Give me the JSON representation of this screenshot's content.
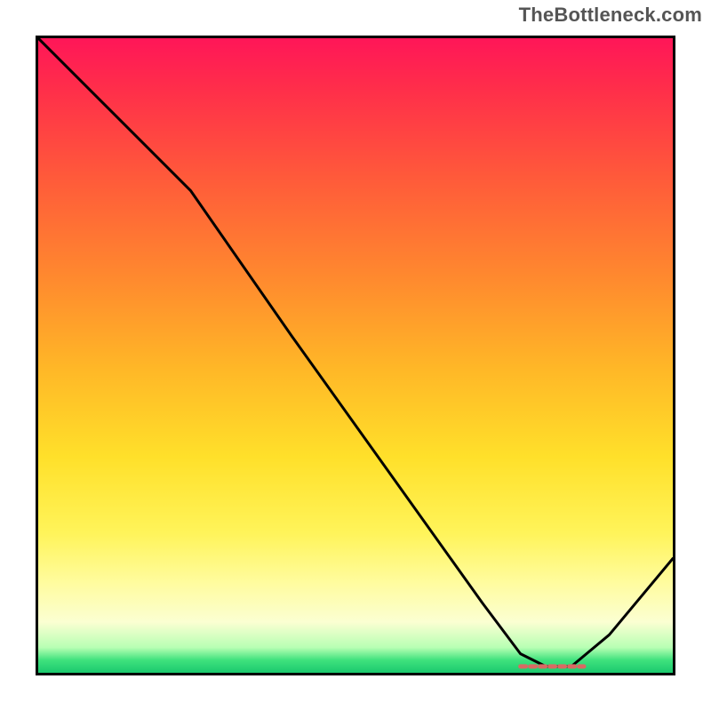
{
  "watermark": "TheBottleneck.com",
  "chart_data": {
    "type": "line",
    "title": "",
    "xlabel": "",
    "ylabel": "",
    "xlim": [
      0,
      100
    ],
    "ylim": [
      0,
      100
    ],
    "grid": false,
    "legend": false,
    "background": {
      "kind": "vertical-gradient",
      "stops": [
        {
          "pos": 0,
          "color": "#ff1658"
        },
        {
          "pos": 0.22,
          "color": "#ff5a3a"
        },
        {
          "pos": 0.52,
          "color": "#ffb727"
        },
        {
          "pos": 0.78,
          "color": "#fff45a"
        },
        {
          "pos": 0.92,
          "color": "#fbffd2"
        },
        {
          "pos": 0.98,
          "color": "#3fe27d"
        },
        {
          "pos": 1.0,
          "color": "#1bc96e"
        }
      ]
    },
    "series": [
      {
        "name": "bottleneck-curve",
        "x": [
          0,
          10,
          20,
          24,
          40,
          55,
          70,
          76,
          80,
          84,
          90,
          100
        ],
        "y": [
          100,
          90,
          80,
          76,
          53,
          32,
          11,
          3,
          1,
          1,
          6,
          18
        ]
      }
    ],
    "annotations": [
      {
        "name": "optimal-flat-segment",
        "kind": "dashed-segment",
        "x_range": [
          76,
          86
        ],
        "y": 1,
        "color": "#d96a63"
      }
    ]
  }
}
